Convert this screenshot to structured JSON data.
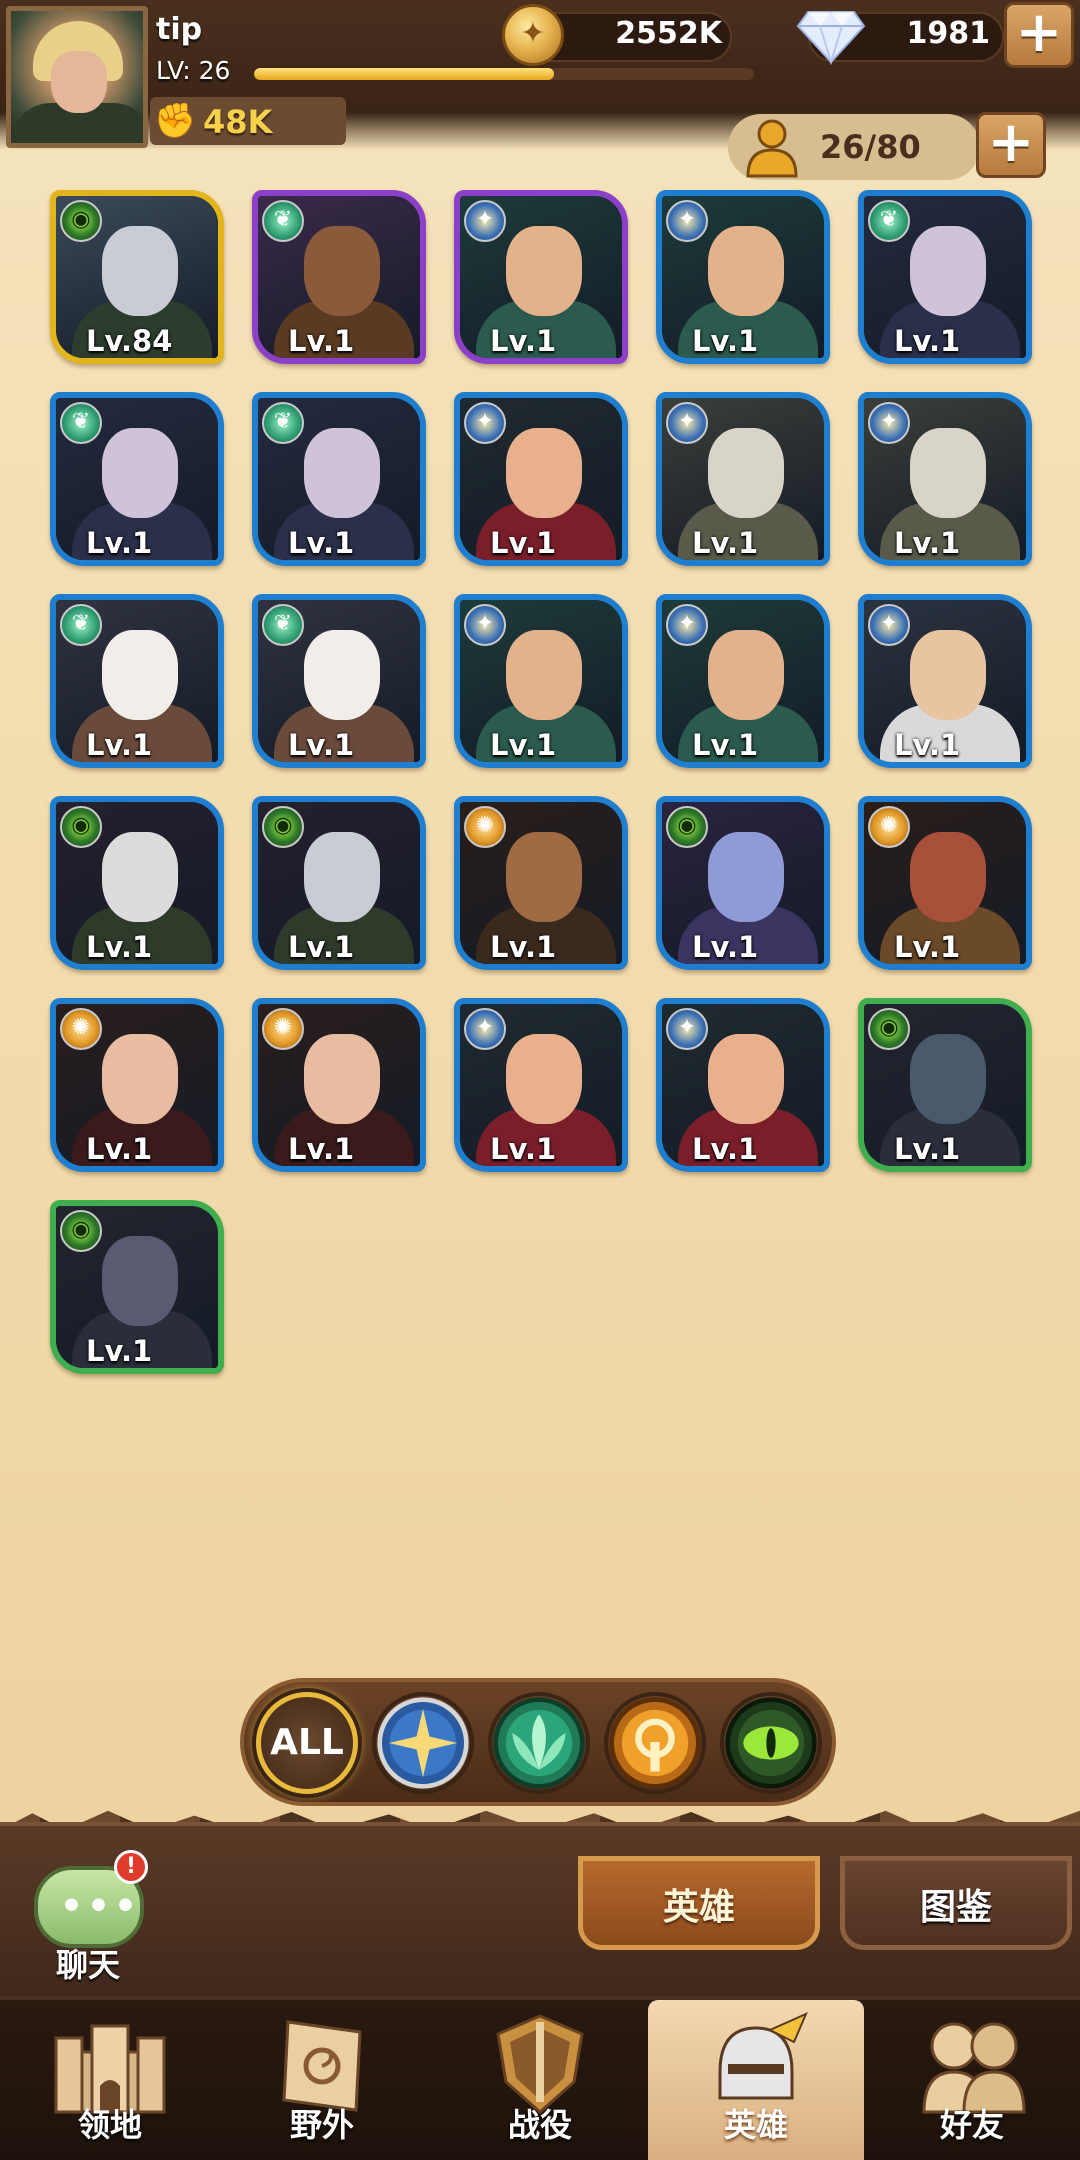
{
  "player": {
    "name": "tip",
    "level_label": "LV: 26",
    "xp_progress": 0.6,
    "power": "48K",
    "gold": "2552K",
    "gems": "1981",
    "roster": "26/80"
  },
  "hero_cards": [
    {
      "level": "Lv.84",
      "faction": "graveborn",
      "frame": "gold"
    },
    {
      "level": "Lv.1",
      "faction": "wilder",
      "frame": "purple"
    },
    {
      "level": "Lv.1",
      "faction": "lightbearer",
      "frame": "purple"
    },
    {
      "level": "Lv.1",
      "faction": "lightbearer",
      "frame": "blue"
    },
    {
      "level": "Lv.1",
      "faction": "wilder",
      "frame": "blue"
    },
    {
      "level": "Lv.1",
      "faction": "wilder",
      "frame": "blue"
    },
    {
      "level": "Lv.1",
      "faction": "wilder",
      "frame": "blue"
    },
    {
      "level": "Lv.1",
      "faction": "lightbearer",
      "frame": "blue"
    },
    {
      "level": "Lv.1",
      "faction": "lightbearer",
      "frame": "blue"
    },
    {
      "level": "Lv.1",
      "faction": "lightbearer",
      "frame": "blue"
    },
    {
      "level": "Lv.1",
      "faction": "wilder",
      "frame": "blue"
    },
    {
      "level": "Lv.1",
      "faction": "wilder",
      "frame": "blue"
    },
    {
      "level": "Lv.1",
      "faction": "lightbearer",
      "frame": "blue"
    },
    {
      "level": "Lv.1",
      "faction": "lightbearer",
      "frame": "blue"
    },
    {
      "level": "Lv.1",
      "faction": "lightbearer",
      "frame": "blue"
    },
    {
      "level": "Lv.1",
      "faction": "graveborn",
      "frame": "blue"
    },
    {
      "level": "Lv.1",
      "faction": "graveborn",
      "frame": "blue"
    },
    {
      "level": "Lv.1",
      "faction": "mauler",
      "frame": "blue"
    },
    {
      "level": "Lv.1",
      "faction": "graveborn",
      "frame": "blue"
    },
    {
      "level": "Lv.1",
      "faction": "mauler",
      "frame": "blue"
    },
    {
      "level": "Lv.1",
      "faction": "mauler",
      "frame": "blue"
    },
    {
      "level": "Lv.1",
      "faction": "mauler",
      "frame": "blue"
    },
    {
      "level": "Lv.1",
      "faction": "lightbearer",
      "frame": "blue"
    },
    {
      "level": "Lv.1",
      "faction": "lightbearer",
      "frame": "blue"
    },
    {
      "level": "Lv.1",
      "faction": "graveborn",
      "frame": "green"
    },
    {
      "level": "Lv.1",
      "faction": "graveborn",
      "frame": "green"
    }
  ],
  "filters": {
    "all_label": "ALL",
    "items": [
      "lightbearer-icon",
      "wilder-icon",
      "mauler-icon",
      "graveborn-icon"
    ]
  },
  "chat": {
    "label": "聊天",
    "badge": "!"
  },
  "tabs": {
    "heroes": "英雄",
    "codex": "图鉴"
  },
  "nav": [
    {
      "label": "领地",
      "icon": "castle-icon"
    },
    {
      "label": "野外",
      "icon": "map-scroll-icon"
    },
    {
      "label": "战役",
      "icon": "battle-shield-icon"
    },
    {
      "label": "英雄",
      "icon": "hero-helmet-icon",
      "active": true
    },
    {
      "label": "好友",
      "icon": "friends-icon"
    }
  ],
  "colors": {
    "parchment": "#f3dfb5",
    "header": "#3a2416",
    "frame_blue": "#1e7fd0",
    "frame_purple": "#8c3fc8",
    "frame_gold": "#e3b51c",
    "frame_green": "#3fae4e"
  }
}
